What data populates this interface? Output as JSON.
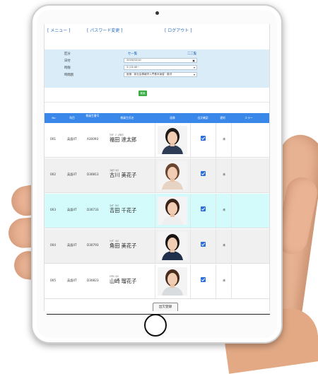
{
  "nav": {
    "menu": "[ メニュー ]",
    "password": "[ パスワード変更 ]",
    "logout": "[ ログアウト ]"
  },
  "filter": {
    "tabs": [
      "セ一覧",
      "二二覧"
    ],
    "labels": [
      "区分",
      "日付",
      "時限",
      "時間割"
    ],
    "date_value": "2020/02/10",
    "period_value": "3 (13:40~",
    "timetable_value": "医療 · 新社会情報学入門基本演習 · 藤沢"
  },
  "search_button": "検索",
  "table": {
    "headers": [
      "No",
      "科目",
      "教員生番号",
      "教員生氏名",
      "画像",
      "出欠確認",
      "遅刻",
      "エラー"
    ],
    "rows": [
      {
        "no": "001",
        "class": "英語4T",
        "id": "A30093",
        "kana": "ｳﾏﾀﾞ ｼﾞｮｳﾀﾛｳ",
        "name": "福田 達太郎",
        "late": "未",
        "highlight": false,
        "shirt": "#2d3b55",
        "hair": "#1d1a19"
      },
      {
        "no": "002",
        "class": "英語4T",
        "id": "D30813",
        "kana": "ﾌﾙｶﾜ ﾐｶｺ",
        "name": "古川 美花子",
        "late": "未",
        "highlight": false,
        "shirt": "#e7d3c3",
        "hair": "#6a4530"
      },
      {
        "no": "003",
        "class": "英語4T",
        "id": "D30733",
        "kana": "ﾖｼﾀﾞ ﾁｶｺ",
        "name": "吉田 千花子",
        "late": "未",
        "highlight": true,
        "shirt": "#efefef",
        "hair": "#3b2418"
      },
      {
        "no": "004",
        "class": "英語4T",
        "id": "D30793",
        "kana": "ﾂﾉﾀﾞ ﾐｶｺ",
        "name": "角田 美花子",
        "late": "未",
        "highlight": false,
        "shirt": "#20304a",
        "hair": "#1a1412"
      },
      {
        "no": "005",
        "class": "英語4T",
        "id": "D30823",
        "kana": "ﾔﾏｻｷ ﾐｶｺ",
        "name": "山崎 瑠花子",
        "late": "未",
        "highlight": false,
        "shirt": "#d9dcdf",
        "hair": "#4a2c1d"
      }
    ]
  },
  "register_button": "出欠登録"
}
